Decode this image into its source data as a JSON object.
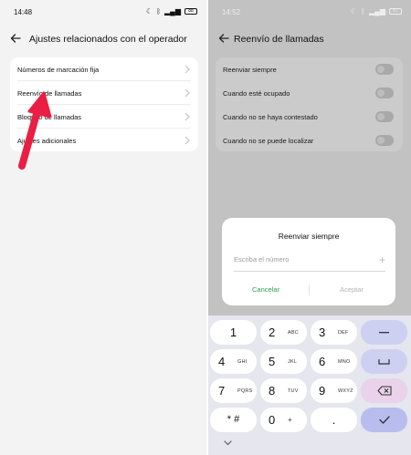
{
  "left": {
    "status": {
      "time": "14:48",
      "battery": "88"
    },
    "title": "Ajustes relacionados con el operador",
    "items": [
      {
        "label": "Números de marcación fija"
      },
      {
        "label": "Reenvío de llamadas"
      },
      {
        "label": "Bloqueo de llamadas"
      },
      {
        "label": "Ajustes adicionales"
      }
    ],
    "annotation_color": "#ea1e44"
  },
  "right": {
    "status": {
      "time": "14:52",
      "battery": "87"
    },
    "title": "Reenvío de llamadas",
    "items": [
      {
        "label": "Reenviar siempre",
        "on": false
      },
      {
        "label": "Cuando esté ocupado",
        "on": false
      },
      {
        "label": "Cuando no se haya contestado",
        "on": false
      },
      {
        "label": "Cuando no se puede localizar",
        "on": false
      }
    ],
    "dialog": {
      "title": "Reenviar siempre",
      "placeholder": "Escriba el número",
      "cancel": "Cancelar",
      "accept": "Aceptar",
      "accent": "#2e9e4f"
    },
    "keyboard": {
      "keys": [
        {
          "num": "1",
          "letters": ""
        },
        {
          "num": "2",
          "letters": "ABC"
        },
        {
          "num": "3",
          "letters": "DEF"
        },
        {
          "num": "4",
          "letters": "GHI"
        },
        {
          "num": "5",
          "letters": "JKL"
        },
        {
          "num": "6",
          "letters": "MNO"
        },
        {
          "num": "7",
          "letters": "PQRS"
        },
        {
          "num": "8",
          "letters": "TUV"
        },
        {
          "num": "9",
          "letters": "WXYZ"
        },
        {
          "num": "* #",
          "letters": ""
        },
        {
          "num": "0",
          "letters": "+"
        },
        {
          "num": ".",
          "letters": ""
        }
      ],
      "function_keys": [
        "minus-icon",
        "space-icon",
        "backspace-icon",
        "check-icon"
      ]
    }
  }
}
